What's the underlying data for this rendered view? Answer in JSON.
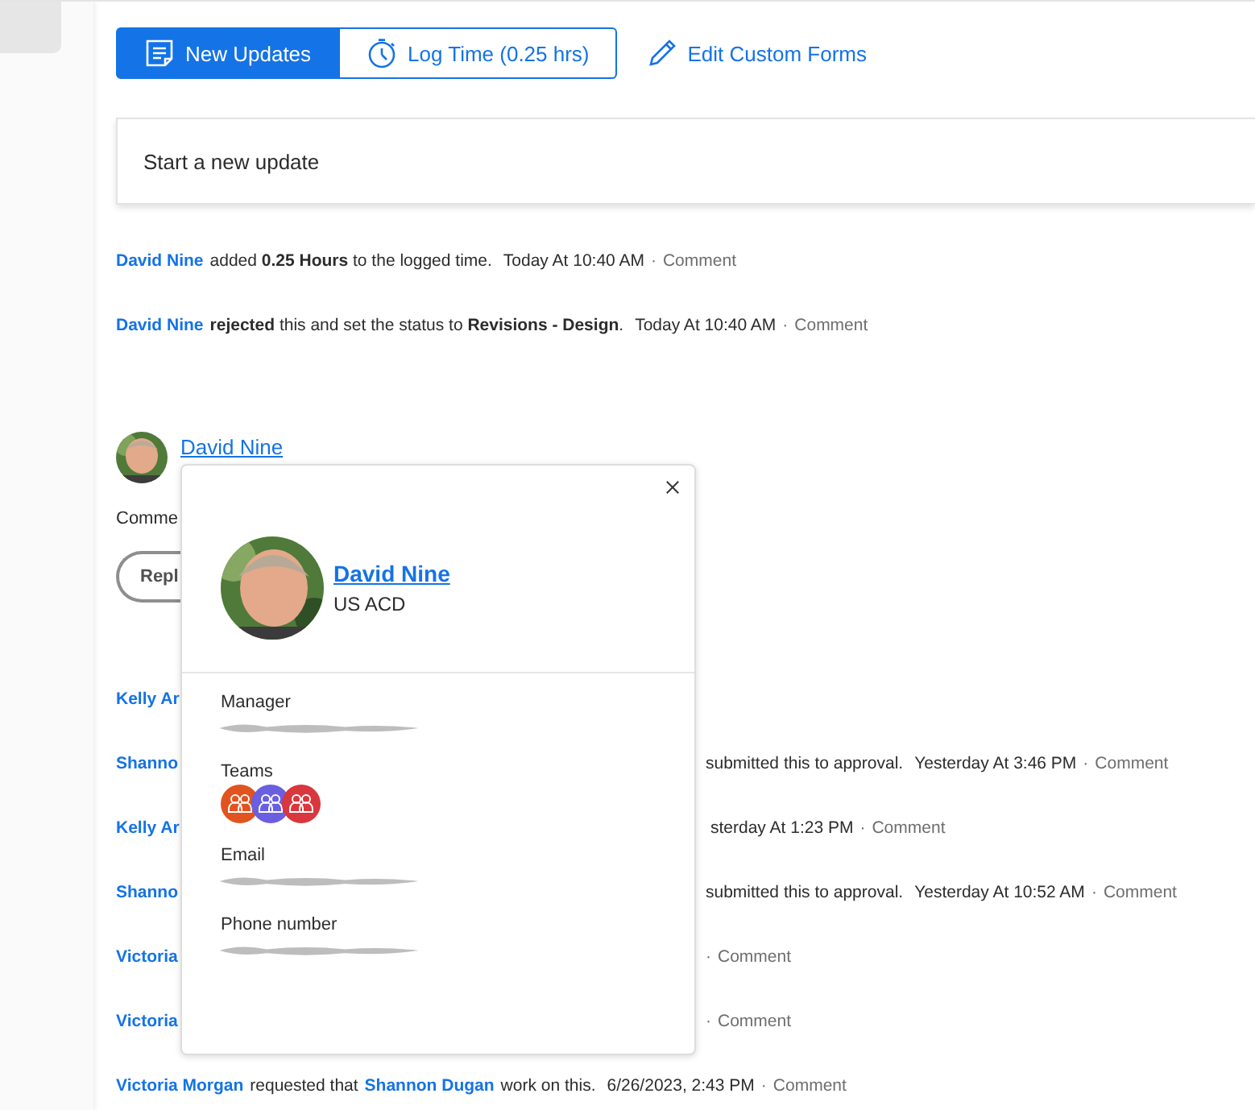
{
  "tabs": [
    {
      "label": "New Updates",
      "selected": true
    },
    {
      "label": "Log Time (0.25 hrs)",
      "selected": false
    }
  ],
  "edit_link": {
    "label": "Edit Custom Forms"
  },
  "update_field": {
    "placeholder": "Start a new update"
  },
  "feed_top": [
    {
      "name": "David Nine",
      "text": "added **0.25 Hours** to the logged time.",
      "time": "Today At 10:40 AM",
      "sep": "·",
      "action": "Comment"
    },
    {
      "name": "David Nine",
      "text": "**rejected** this and set the status to **Revisions - Design**.",
      "time": "Today At 10:40 AM",
      "sep": "·",
      "action": "Comment"
    }
  ],
  "comment": {
    "author": "David Nine",
    "text": "Comme",
    "reply_button": "Repl"
  },
  "feed_bottom": [
    {
      "kind": "covered",
      "name": "Kelly Ar"
    },
    {
      "kind": "covered",
      "name": "Shanno",
      "text": "submitted this to approval.",
      "time": "Yesterday At 3:46 PM",
      "sep": "·",
      "action": "Comment"
    },
    {
      "kind": "covered",
      "name": "Kelly Ar",
      "time": "sterday At 1:23 PM",
      "sep": "·",
      "action": "Comment"
    },
    {
      "kind": "covered",
      "name": "Shanno",
      "text": "submitted this to approval.",
      "time": "Yesterday At 10:52 AM",
      "sep": "·",
      "action": "Comment"
    },
    {
      "kind": "covered",
      "name": "Victoria",
      "sep": "·",
      "action": "Comment"
    },
    {
      "kind": "covered",
      "name": "Victoria",
      "sep": "·",
      "action": "Comment"
    },
    {
      "kind": "full",
      "name": "Victoria Morgan",
      "text": "requested that",
      "mention": "Shannon Dugan",
      "text2": "work on this.",
      "time": "6/26/2023, 2:43 PM",
      "sep": "·",
      "action": "Comment"
    }
  ],
  "profile_card": {
    "name": "David Nine",
    "subtitle": "US ACD",
    "fields": [
      {
        "label": "Manager",
        "kind": "redacted"
      },
      {
        "label": "Teams",
        "kind": "teams",
        "teams": [
          {
            "color": "#e1531f"
          },
          {
            "color": "#6a5fe0"
          },
          {
            "color": "#d9363e"
          }
        ]
      },
      {
        "label": "Email",
        "kind": "redacted"
      },
      {
        "label": "Phone number",
        "kind": "redacted"
      }
    ]
  }
}
